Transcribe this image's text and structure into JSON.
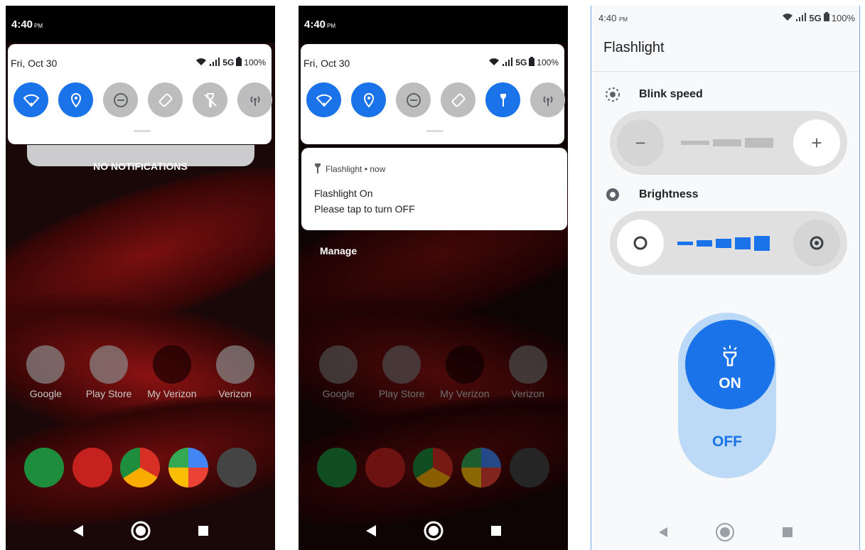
{
  "screen1": {
    "status": {
      "time": "4:40",
      "ampm": "PM"
    },
    "qs": {
      "date": "Fri, Oct 30",
      "network": "5G",
      "battery": "100%"
    },
    "no_notifications": "NO NOTIFICATIONS",
    "apps": [
      "Google",
      "Play Store",
      "My Verizon",
      "Verizon"
    ]
  },
  "screen2": {
    "status": {
      "time": "4:40",
      "ampm": "PM"
    },
    "qs": {
      "date": "Fri, Oct 30",
      "network": "5G",
      "battery": "100%"
    },
    "notification": {
      "app_line": "Flashlight • now",
      "title": "Flashlight On",
      "body": "Please tap to turn OFF"
    },
    "manage": "Manage",
    "apps": [
      "Google",
      "Play Store",
      "My Verizon",
      "Verizon"
    ]
  },
  "screen3": {
    "status": {
      "time": "4:40",
      "ampm": "PM",
      "network": "5G",
      "battery": "100%"
    },
    "title": "Flashlight",
    "blink_speed_label": "Blink speed",
    "brightness_label": "Brightness",
    "on_label": "ON",
    "off_label": "OFF"
  },
  "colors": {
    "accent": "#1a73e8",
    "tile_off": "#bdbdbd",
    "pill": "#bcdaf7"
  }
}
